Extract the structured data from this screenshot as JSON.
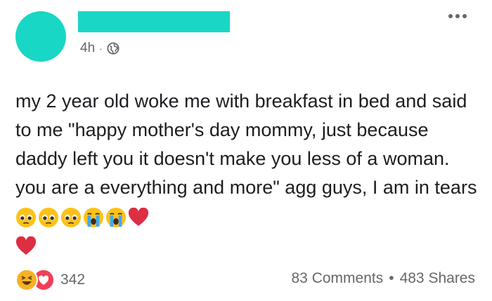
{
  "post": {
    "timestamp": "4h",
    "separator": "·",
    "text_main": "my 2 year old woke me with breakfast in bed and said to me \"happy mother's day mommy, just because daddy left you it doesn't make you less of a woman. you are a everything and more\" agg guys, I am in tears",
    "emojis": [
      "pleading-face",
      "pleading-face",
      "pleading-face",
      "loudly-crying-face",
      "loudly-crying-face",
      "red-heart",
      "red-heart"
    ],
    "colors": {
      "redaction": "#18d7c4",
      "meta_gray": "#65676b",
      "haha": "#f7b125",
      "care": "#f33e58",
      "heart": "#e0245e"
    }
  },
  "footer": {
    "reaction_count": "342",
    "comments": "83 Comments",
    "dot": "•",
    "shares": "483 Shares"
  }
}
